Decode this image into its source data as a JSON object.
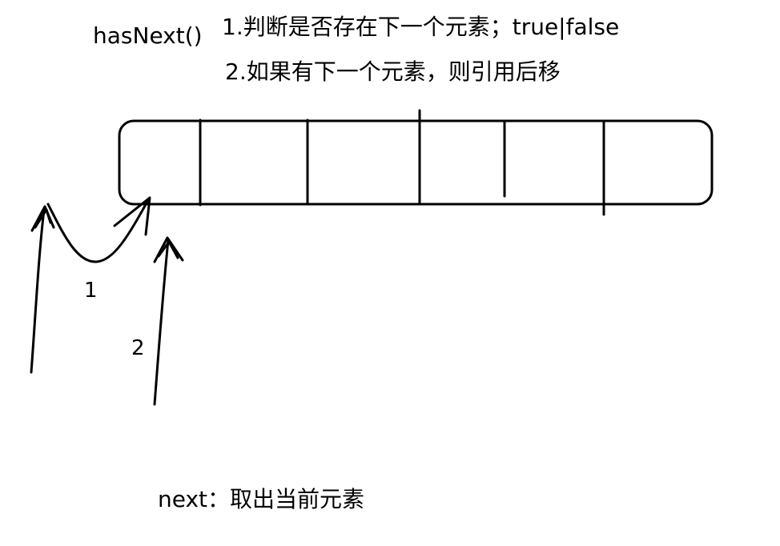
{
  "title": "hasNext()",
  "steps": [
    "1.判断是否存在下一个元素；true|false",
    "2.如果有下一个元素，则引用后移"
  ],
  "arrow_labels": [
    "1",
    "2"
  ],
  "next_note": "next：取出当前元素"
}
